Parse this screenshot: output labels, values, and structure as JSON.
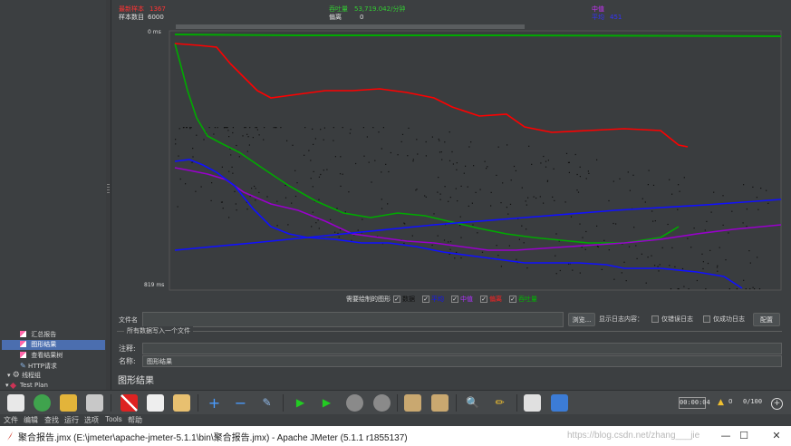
{
  "window": {
    "title": "聚合报告.jmx (E:\\jmeter\\apache-jmeter-5.1.1\\bin\\聚合报告.jmx) - Apache JMeter (5.1.1 r1855137)",
    "watermark": "https://blog.csdn.net/zhang___jie"
  },
  "menubar": {
    "items": [
      "文件",
      "编辑",
      "查找",
      "运行",
      "选项",
      "Tools",
      "帮助"
    ]
  },
  "toolbar": {
    "timer": "00:00:04",
    "warn_count": "0",
    "threads": "0/100"
  },
  "tree": {
    "items": [
      {
        "label": "Test Plan",
        "icon": "test-plan-icon",
        "selected": false
      },
      {
        "label": "线程组",
        "icon": "gear-icon",
        "selected": false
      },
      {
        "label": "HTTP请求",
        "icon": "pipette-icon",
        "selected": false
      },
      {
        "label": "查看结果树",
        "icon": "chart-icon",
        "selected": false
      },
      {
        "label": "图形结果",
        "icon": "chart-icon",
        "selected": true
      },
      {
        "label": "汇总报告",
        "icon": "chart-icon",
        "selected": false
      }
    ]
  },
  "panel": {
    "title": "图形结果",
    "name_label": "名称:",
    "name_value": "图形结果",
    "comment_label": "注释:",
    "comment_value": "",
    "group_title": "所有数据写入一个文件",
    "file_label": "文件名",
    "browse_label": "浏览...",
    "log_display_label": "显示日志内容：",
    "errors_only_label": "仅错误日志",
    "success_only_label": "仅成功日志",
    "configure_label": "配置"
  },
  "graph": {
    "legend": [
      {
        "label": "数据",
        "color": "#111111"
      },
      {
        "label": "平均",
        "color": "#1010ff"
      },
      {
        "label": "中值",
        "color": "#9900cc"
      },
      {
        "label": "偏离",
        "color": "#ff0000"
      },
      {
        "label": "吞吐量",
        "color": "#00aa00"
      }
    ],
    "show_label": "需要绘制的图形",
    "stats": {
      "samples_label": "样本数目",
      "samples_value": "6000",
      "latest_label": "最新样本",
      "latest_value": "1367",
      "average_label": "平均",
      "average_value": "451",
      "deviation_label": "偏离",
      "deviation_value": "",
      "throughput_label": "吞吐量",
      "throughput_value": "53,719.042/分钟",
      "median_label": "中值",
      "median_value": "",
      "deviation_note": "偏离",
      "fail": "0"
    },
    "y_top": "0 ms",
    "y_bottom": "819 ms",
    "colors": {
      "average": "#1010ff",
      "median": "#9900cc",
      "deviation": "#ff0000",
      "throughput": "#00aa00",
      "data": "#111111",
      "plot_bg": "#3c3f41"
    }
  }
}
